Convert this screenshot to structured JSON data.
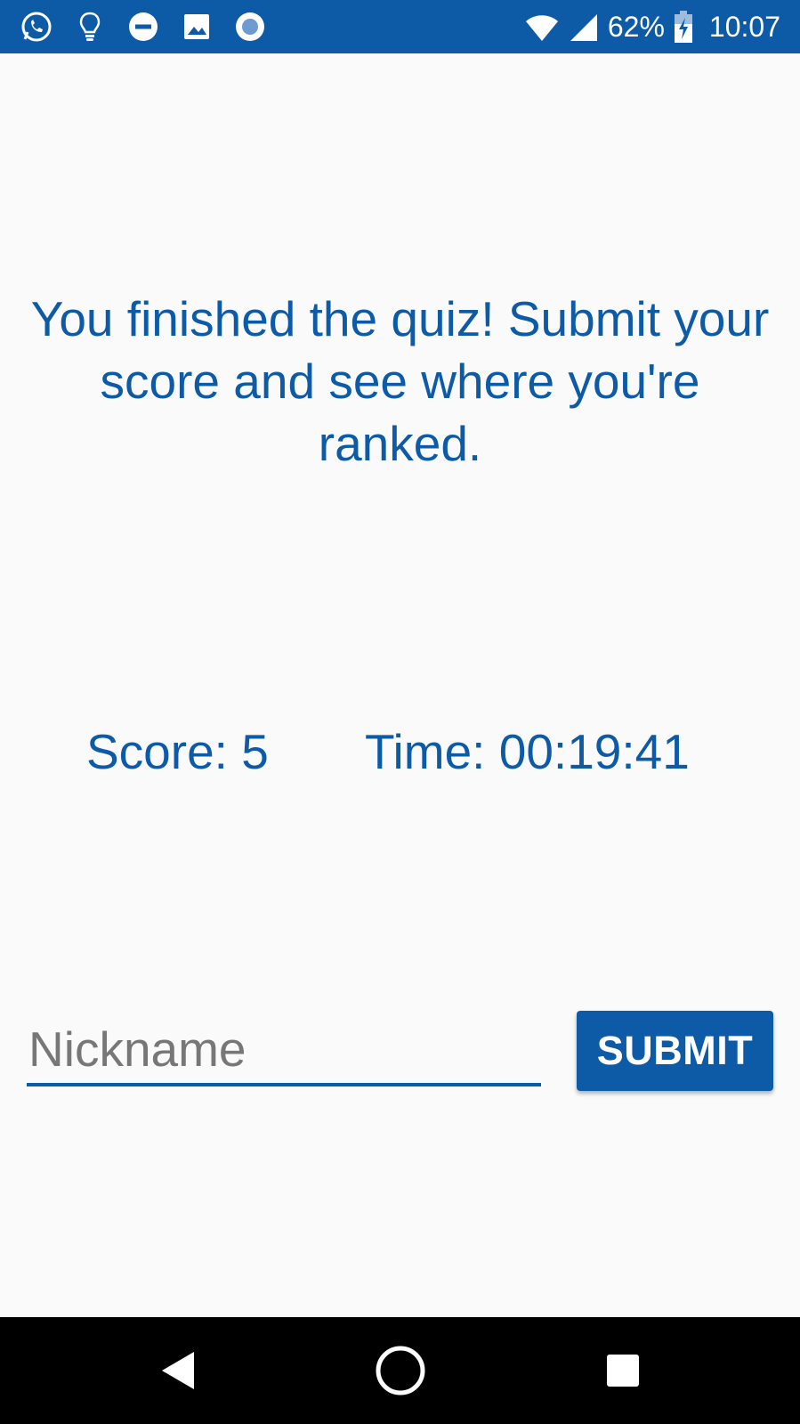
{
  "status_bar": {
    "left_icons": [
      "whatsapp-icon",
      "lightbulb-icon",
      "do-not-disturb-icon",
      "image-icon",
      "record-icon"
    ],
    "battery_percent": "62%",
    "time": "10:07",
    "background": "#0d5aa7"
  },
  "quiz_result": {
    "headline": "You finished the quiz! Submit your score and see where you're ranked.",
    "score_text": "Score: 5",
    "time_text": "Time: 00:19:41"
  },
  "submission": {
    "nickname_value": "",
    "nickname_placeholder": "Nickname",
    "submit_label": "SUBMIT"
  },
  "nav_bar": {
    "icons": [
      "back-icon",
      "home-icon",
      "recents-icon"
    ]
  },
  "colors": {
    "accent": "#0d5aa7",
    "background": "#fafafa",
    "placeholder": "#777777"
  }
}
